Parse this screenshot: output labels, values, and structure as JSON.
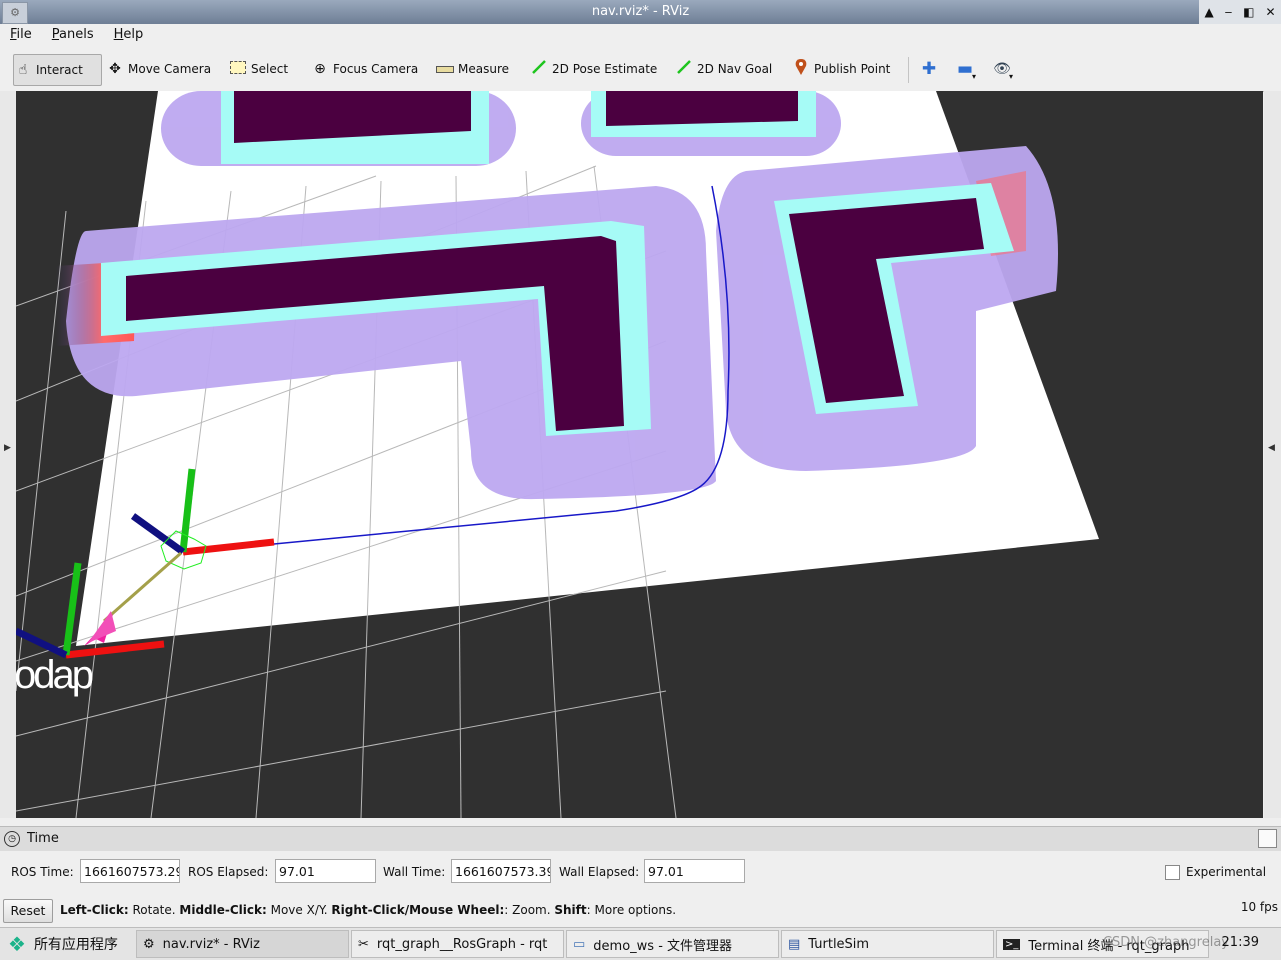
{
  "window": {
    "title": "nav.rviz* - RViz",
    "app_icon": "rviz-icon",
    "controls": [
      "▲",
      "‒",
      "◧",
      "✕"
    ]
  },
  "menu": [
    "File",
    "Panels",
    "Help"
  ],
  "toolbar": {
    "interact": "Interact",
    "move_camera": "Move Camera",
    "select": "Select",
    "focus_camera": "Focus Camera",
    "measure": "Measure",
    "pose_estimate": "2D Pose Estimate",
    "nav_goal": "2D Nav Goal",
    "publish_point": "Publish Point"
  },
  "viewport": {
    "frame_label": "odap",
    "colors": {
      "background": "#303030",
      "free": "#ffffff",
      "obstacle": "#4b0040",
      "inflated_edge": "#a6fbf6",
      "inflation": "#b9a6ef",
      "path": "#1818c8"
    }
  },
  "time_panel": {
    "title": "Time",
    "ros_time_label": "ROS Time:",
    "ros_time": "1661607573.29",
    "ros_elapsed_label": "ROS Elapsed:",
    "ros_elapsed": "97.01",
    "wall_time_label": "Wall Time:",
    "wall_time": "1661607573.39",
    "wall_elapsed_label": "Wall Elapsed:",
    "wall_elapsed": "97.01",
    "experimental_label": "Experimental"
  },
  "status": {
    "reset": "Reset",
    "left_click": "Left-Click:",
    "left_click_desc": " Rotate. ",
    "middle_click": "Middle-Click:",
    "middle_click_desc": " Move X/Y. ",
    "right_click": "Right-Click/Mouse Wheel:",
    "right_click_desc": ": Zoom. ",
    "shift": "Shift",
    "shift_desc": ": More options.",
    "fps": "10 fps"
  },
  "taskbar": {
    "start": "所有应用程序",
    "tasks": [
      "nav.rviz* - RViz",
      "rqt_graph__RosGraph - rqt",
      "demo_ws - 文件管理器",
      "TurtleSim",
      "Terminal 终端 - rqt_graph"
    ],
    "clock": "21:39",
    "watermark": "CSDN @zhangrelay"
  }
}
